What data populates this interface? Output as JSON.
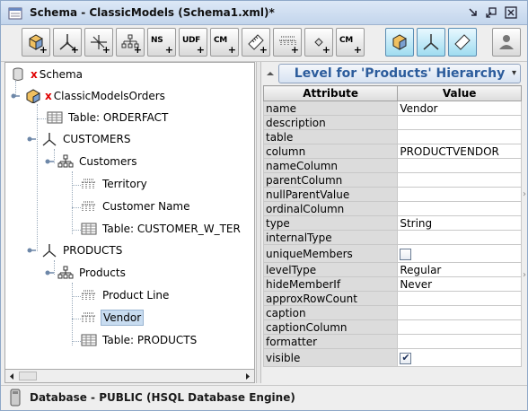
{
  "window": {
    "title": "Schema - ClassicModels (Schema1.xml)*"
  },
  "toolbar": {
    "buttons": [
      {
        "name": "add-cube-button",
        "label": ""
      },
      {
        "name": "add-dimension-button",
        "label": ""
      },
      {
        "name": "add-dimension-usage-button",
        "label": ""
      },
      {
        "name": "add-hierarchy-button",
        "label": ""
      },
      {
        "name": "add-named-set-button",
        "label": "NS"
      },
      {
        "name": "add-udf-button",
        "label": "UDF"
      },
      {
        "name": "add-calculated-member-button",
        "label": "CM"
      },
      {
        "name": "add-measure-button",
        "label": ""
      },
      {
        "name": "add-level-button",
        "label": ""
      },
      {
        "name": "add-property-button",
        "label": ""
      },
      {
        "name": "add-calculated-member-2-button",
        "label": "CM"
      },
      {
        "name": "edit-mode-button",
        "label": ""
      },
      {
        "name": "preview-button",
        "label": ""
      },
      {
        "name": "view-xml-button",
        "label": ""
      },
      {
        "name": "user-button",
        "label": ""
      }
    ]
  },
  "tree": {
    "root": {
      "prefix": "x",
      "label": "Schema"
    },
    "cube": {
      "prefix": "x",
      "label": "ClassicModelsOrders"
    },
    "fact_table": "Table: ORDERFACT",
    "dim_customers": "CUSTOMERS",
    "hier_customers": "Customers",
    "lvl_territory": "Territory",
    "lvl_customer_name": "Customer Name",
    "table_customer": "Table: CUSTOMER_W_TER",
    "dim_products": "PRODUCTS",
    "hier_products": "Products",
    "lvl_product_line": "Product Line",
    "lvl_vendor": "Vendor",
    "table_products": "Table: PRODUCTS"
  },
  "panel": {
    "header": "Level for 'Products' Hierarchy",
    "col_attribute": "Attribute",
    "col_value": "Value"
  },
  "properties": [
    {
      "attr": "name",
      "value": "Vendor"
    },
    {
      "attr": "description",
      "value": ""
    },
    {
      "attr": "table",
      "value": ""
    },
    {
      "attr": "column",
      "value": "PRODUCTVENDOR"
    },
    {
      "attr": "nameColumn",
      "value": ""
    },
    {
      "attr": "parentColumn",
      "value": ""
    },
    {
      "attr": "nullParentValue",
      "value": ""
    },
    {
      "attr": "ordinalColumn",
      "value": ""
    },
    {
      "attr": "type",
      "value": "String"
    },
    {
      "attr": "internalType",
      "value": ""
    },
    {
      "attr": "uniqueMembers",
      "checkbox": false
    },
    {
      "attr": "levelType",
      "value": "Regular"
    },
    {
      "attr": "hideMemberIf",
      "value": "Never"
    },
    {
      "attr": "approxRowCount",
      "value": ""
    },
    {
      "attr": "caption",
      "value": ""
    },
    {
      "attr": "captionColumn",
      "value": ""
    },
    {
      "attr": "formatter",
      "value": ""
    },
    {
      "attr": "visible",
      "checkbox": true
    }
  ],
  "status": {
    "text": "Database - PUBLIC (HSQL Database Engine)"
  },
  "colors": {
    "accent": "#2c5c9c",
    "selection": "#c8dcf0",
    "error_prefix": "#e00000"
  }
}
